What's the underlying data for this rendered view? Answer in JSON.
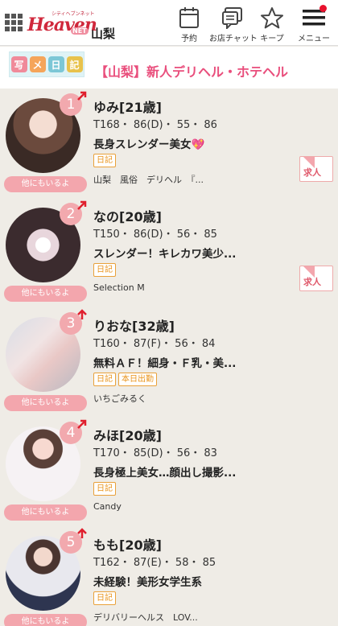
{
  "header": {
    "logo_small": "シティヘブンネット",
    "logo_big": "Heaven",
    "logo_net": "NET",
    "region": "山梨",
    "nav": [
      {
        "label": "予約",
        "icon": "calendar-icon"
      },
      {
        "label": "お店チャット",
        "icon": "chat-icon"
      },
      {
        "label": "キープ",
        "icon": "star-icon"
      },
      {
        "label": "メニュー",
        "icon": "menu-icon"
      }
    ]
  },
  "banner": {
    "diary_chars": [
      "写",
      "メ",
      "日",
      "記"
    ],
    "title": "【山梨】新人デリヘル・ホテヘル"
  },
  "colors": {
    "accent": "#e94e7c",
    "rank_badge": "#f2a9ae",
    "tag": "#e9931a",
    "background": "#efece6"
  },
  "cards": [
    {
      "rank": "1",
      "name": "ゆみ[21歳]",
      "size": "T168・ 86(D)・ 55・ 86",
      "catch": "長身スレンダー美女💖",
      "tags": [
        "日記"
      ],
      "shop": "山梨　風俗　デリヘル　『...",
      "also": "他にもいるよ",
      "recruit": "求人"
    },
    {
      "rank": "2",
      "name": "なの[20歳]",
      "size": "T150・ 86(D)・ 56・ 85",
      "catch": "スレンダー！キレカワ美少...",
      "tags": [
        "日記"
      ],
      "shop": "Selection M",
      "also": "他にもいるよ",
      "recruit": "求人"
    },
    {
      "rank": "3",
      "name": "りおな[32歳]",
      "size": "T160・ 87(F)・ 56・ 84",
      "catch": "無料ＡＦ！細身・Ｆ乳・美...",
      "tags": [
        "日記",
        "本日出勤"
      ],
      "shop": "いちごみるく",
      "also": "他にもいるよ",
      "recruit": ""
    },
    {
      "rank": "4",
      "name": "みほ[20歳]",
      "size": "T170・ 85(D)・ 56・ 83",
      "catch": "長身極上美女…顔出し撮影...",
      "tags": [
        "日記"
      ],
      "shop": "Candy",
      "also": "他にもいるよ",
      "recruit": ""
    },
    {
      "rank": "5",
      "name": "もも[20歳]",
      "size": "T162・ 87(E)・ 58・ 85",
      "catch": "未経験！美形女学生系",
      "tags": [
        "日記"
      ],
      "shop": "デリバリーヘルス　LOV...",
      "also": "他にもいるよ",
      "recruit": ""
    }
  ]
}
